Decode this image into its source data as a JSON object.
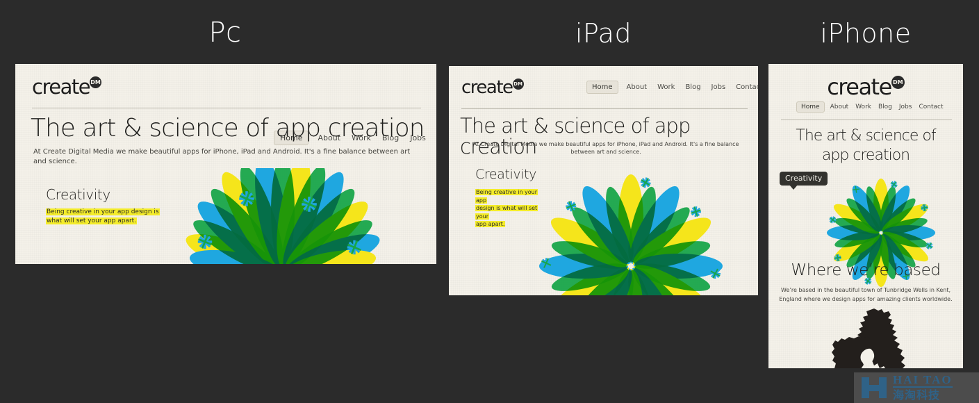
{
  "background_color": "#2b2b2b",
  "panel_color": "#f4f1e9",
  "accent_colors": {
    "highlight_yellow": "#f4ec2a",
    "petal_yellow": "#f5e51b",
    "petal_blue": "#1fa7e0",
    "petal_green": "#18a54a",
    "text_dark": "#1f1f1d"
  },
  "devices": [
    {
      "caption": "Pc"
    },
    {
      "caption": "iPad"
    },
    {
      "caption": "iPhone"
    }
  ],
  "site": {
    "logo_text": "create",
    "logo_badge": "DM",
    "nav": [
      {
        "label": "Home",
        "active": true
      },
      {
        "label": "About",
        "active": false
      },
      {
        "label": "Work",
        "active": false
      },
      {
        "label": "Blog",
        "active": false
      },
      {
        "label": "Jobs",
        "active": false
      },
      {
        "label": "Contact",
        "active": false
      }
    ],
    "headline": "The art & science of app creation",
    "headline_line1": "The art & science of",
    "headline_line2": "app creation",
    "subhead": "At Create Digital Media we make beautiful apps for iPhone, iPad and Android. It's a fine balance between art and science.",
    "creativity_title": "Creativity",
    "creativity_body": "Being creative in your app design is what will set your app apart.",
    "creativity_body_pc_line1": "Being creative in your app design is",
    "creativity_body_pc_line2": "what will set your app apart.",
    "creativity_body_ipad_line1": "Being creative in your app",
    "creativity_body_ipad_line2": "design is what will set your",
    "creativity_body_ipad_line3": "app apart.",
    "based_title": "Where we’re based",
    "based_body_line1": "We’re based in the beautiful town of Tunbridge Wells in Kent,",
    "based_body_line2": "England where we design apps for amazing clients worldwide."
  },
  "watermark": {
    "english": "HAI TAO",
    "chinese": "海淘科技",
    "color": "#2f6287",
    "background": "#4c4c4c"
  }
}
